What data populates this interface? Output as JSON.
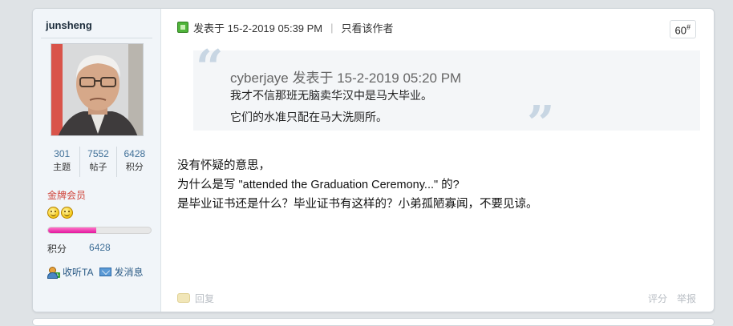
{
  "author": {
    "username": "junsheng",
    "stats": [
      {
        "value": "301",
        "label": "主题"
      },
      {
        "value": "7552",
        "label": "帖子"
      },
      {
        "value": "6428",
        "label": "积分"
      }
    ],
    "rank": "金牌会员",
    "points_label": "积分",
    "points_value": "6428",
    "progress_percent": 47,
    "follow_label": "收听TA",
    "message_label": "发消息"
  },
  "post": {
    "posted_label": "发表于 15-2-2019 05:39 PM",
    "separator": "|",
    "only_author_label": "只看该作者",
    "floor": "60",
    "floor_suffix": "#",
    "quote": {
      "open_mark": "“",
      "close_mark": "”",
      "author": "cyberjaye",
      "posted": "发表于 15-2-2019 05:20 PM",
      "lines": [
        "我才不信那班无脑卖华汉中是马大毕业。",
        "它们的水准只配在马大洗厕所。"
      ]
    },
    "body": [
      "没有怀疑的意思，",
      "为什么是写 \"attended the Graduation Ceremony...\" 的?",
      "是毕业证书还是什么？毕业证书有这样的？小弟孤陋寡闻，不要见谅。"
    ]
  },
  "footer": {
    "reply_label": "回复",
    "rate_label": "评分",
    "report_label": "举报"
  }
}
